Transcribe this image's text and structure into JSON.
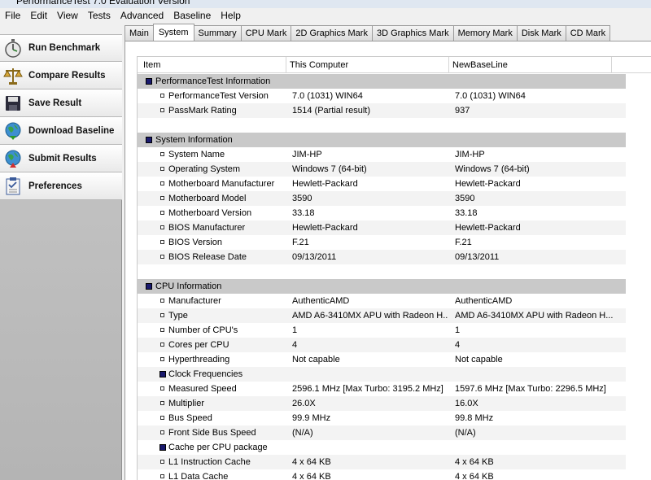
{
  "window": {
    "title": "PerformanceTest 7.0 Evaluation Version"
  },
  "menu": [
    "File",
    "Edit",
    "View",
    "Tests",
    "Advanced",
    "Baseline",
    "Help"
  ],
  "sidebar": [
    {
      "label": "Run Benchmark",
      "icon": "stopwatch-icon"
    },
    {
      "label": "Compare Results",
      "icon": "scales-icon"
    },
    {
      "label": "Save Result",
      "icon": "floppy-disk-icon"
    },
    {
      "label": "Download Baseline",
      "icon": "globe-download-icon"
    },
    {
      "label": "Submit Results",
      "icon": "globe-upload-icon"
    },
    {
      "label": "Preferences",
      "icon": "clipboard-icon"
    }
  ],
  "tabs": [
    "Main",
    "System",
    "Summary",
    "CPU Mark",
    "2D Graphics Mark",
    "3D Graphics Mark",
    "Memory Mark",
    "Disk Mark",
    "CD Mark"
  ],
  "active_tab": "System",
  "columns": [
    "Item",
    "This Computer",
    "NewBaseLine"
  ],
  "rows": [
    {
      "type": "section",
      "label": "PerformanceTest Information"
    },
    {
      "type": "item",
      "label": "PerformanceTest Version",
      "c2": "7.0 (1031) WIN64",
      "c3": "7.0 (1031) WIN64"
    },
    {
      "type": "item",
      "label": "PassMark Rating",
      "c2": "1514 (Partial result)",
      "c3": "937"
    },
    {
      "type": "spacer"
    },
    {
      "type": "section",
      "label": "System Information"
    },
    {
      "type": "item",
      "label": "System Name",
      "c2": "JIM-HP",
      "c3": "JIM-HP"
    },
    {
      "type": "item",
      "label": "Operating System",
      "c2": "Windows 7 (64-bit)",
      "c3": "Windows 7 (64-bit)"
    },
    {
      "type": "item",
      "label": "Motherboard Manufacturer",
      "c2": "Hewlett-Packard",
      "c3": "Hewlett-Packard"
    },
    {
      "type": "item",
      "label": "Motherboard Model",
      "c2": "3590",
      "c3": "3590"
    },
    {
      "type": "item",
      "label": "Motherboard Version",
      "c2": "33.18",
      "c3": "33.18"
    },
    {
      "type": "item",
      "label": "BIOS Manufacturer",
      "c2": "Hewlett-Packard",
      "c3": "Hewlett-Packard"
    },
    {
      "type": "item",
      "label": "BIOS Version",
      "c2": "F.21",
      "c3": "F.21"
    },
    {
      "type": "item",
      "label": "BIOS Release Date",
      "c2": "09/13/2011",
      "c3": "09/13/2011"
    },
    {
      "type": "spacer"
    },
    {
      "type": "section",
      "label": "CPU Information"
    },
    {
      "type": "item",
      "label": "Manufacturer",
      "c2": "AuthenticAMD",
      "c3": "AuthenticAMD"
    },
    {
      "type": "item",
      "label": "Type",
      "c2": "AMD A6-3410MX APU with Radeon H...",
      "c3": "AMD A6-3410MX APU with Radeon H..."
    },
    {
      "type": "item",
      "label": "Number of CPU's",
      "c2": "1",
      "c3": "1"
    },
    {
      "type": "item",
      "label": "Cores per CPU",
      "c2": "4",
      "c3": "4"
    },
    {
      "type": "item",
      "label": "Hyperthreading",
      "c2": "Not capable",
      "c3": "Not capable"
    },
    {
      "type": "subsection",
      "label": "Clock Frequencies"
    },
    {
      "type": "item",
      "label": "Measured Speed",
      "c2": "2596.1 MHz [Max Turbo: 3195.2 MHz]",
      "c3": "1597.6 MHz [Max Turbo: 2296.5 MHz]"
    },
    {
      "type": "item",
      "label": "Multiplier",
      "c2": "26.0X",
      "c3": "16.0X"
    },
    {
      "type": "item",
      "label": "Bus Speed",
      "c2": "99.9 MHz",
      "c3": "99.8 MHz"
    },
    {
      "type": "item",
      "label": "Front Side Bus Speed",
      "c2": "(N/A)",
      "c3": "(N/A)"
    },
    {
      "type": "subsection",
      "label": "Cache per CPU package"
    },
    {
      "type": "item",
      "label": "L1 Instruction Cache",
      "c2": "4 x 64 KB",
      "c3": "4 x 64 KB"
    },
    {
      "type": "item",
      "label": "L1 Data Cache",
      "c2": "4 x 64 KB",
      "c3": "4 x 64 KB"
    }
  ]
}
